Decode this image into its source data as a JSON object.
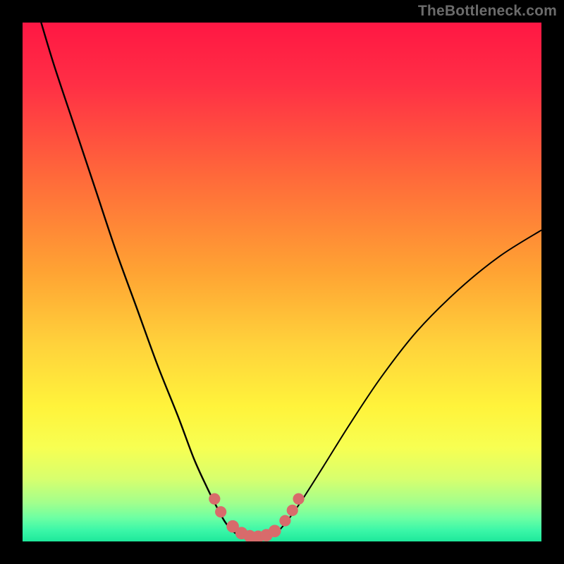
{
  "watermark": {
    "text": "TheBottleneck.com"
  },
  "colors": {
    "bg_black": "#000000",
    "curve": "#000000",
    "marker_fill": "#d86b6b",
    "marker_stroke": "#d86b6b"
  },
  "chart_data": {
    "type": "line",
    "title": "",
    "xlabel": "",
    "ylabel": "",
    "xlim": [
      0,
      100
    ],
    "ylim": [
      0,
      100
    ],
    "gradient_stops": [
      {
        "offset": 0.0,
        "color": "#ff1744"
      },
      {
        "offset": 0.12,
        "color": "#ff2f45"
      },
      {
        "offset": 0.3,
        "color": "#ff6a3a"
      },
      {
        "offset": 0.48,
        "color": "#ffa333"
      },
      {
        "offset": 0.62,
        "color": "#ffd23b"
      },
      {
        "offset": 0.74,
        "color": "#fff33b"
      },
      {
        "offset": 0.82,
        "color": "#f7ff52"
      },
      {
        "offset": 0.88,
        "color": "#d7ff6e"
      },
      {
        "offset": 0.925,
        "color": "#a3ff8c"
      },
      {
        "offset": 0.955,
        "color": "#6cffa3"
      },
      {
        "offset": 0.978,
        "color": "#3cf7a8"
      },
      {
        "offset": 1.0,
        "color": "#1ee89b"
      }
    ],
    "series": [
      {
        "name": "left-curve",
        "x": [
          3.0,
          6.0,
          10.0,
          14.0,
          18.0,
          22.0,
          26.0,
          30.0,
          33.0,
          35.5,
          37.5,
          39.0,
          40.5,
          42.0
        ],
        "y": [
          102.0,
          92.0,
          80.0,
          68.0,
          56.0,
          45.0,
          34.0,
          24.0,
          16.0,
          10.5,
          6.5,
          3.8,
          2.0,
          1.0
        ]
      },
      {
        "name": "bottom-curve",
        "x": [
          42.0,
          43.5,
          45.0,
          46.5,
          48.0
        ],
        "y": [
          1.0,
          0.6,
          0.5,
          0.6,
          1.0
        ]
      },
      {
        "name": "right-curve",
        "x": [
          48.0,
          49.5,
          51.5,
          54.0,
          58.0,
          63.0,
          69.0,
          76.0,
          84.0,
          92.0,
          100.0
        ],
        "y": [
          1.0,
          2.2,
          4.6,
          8.2,
          14.5,
          22.5,
          31.5,
          40.5,
          48.5,
          55.0,
          60.0
        ]
      }
    ],
    "markers": [
      {
        "x": 37.0,
        "y": 8.2,
        "r": 1.1
      },
      {
        "x": 38.2,
        "y": 5.7,
        "r": 1.1
      },
      {
        "x": 40.5,
        "y": 2.9,
        "r": 1.2
      },
      {
        "x": 42.2,
        "y": 1.6,
        "r": 1.2
      },
      {
        "x": 43.8,
        "y": 1.0,
        "r": 1.2
      },
      {
        "x": 45.4,
        "y": 0.9,
        "r": 1.2
      },
      {
        "x": 47.0,
        "y": 1.2,
        "r": 1.2
      },
      {
        "x": 48.6,
        "y": 2.0,
        "r": 1.2
      },
      {
        "x": 50.6,
        "y": 4.0,
        "r": 1.1
      },
      {
        "x": 52.0,
        "y": 6.0,
        "r": 1.1
      },
      {
        "x": 53.2,
        "y": 8.2,
        "r": 1.1
      }
    ]
  }
}
